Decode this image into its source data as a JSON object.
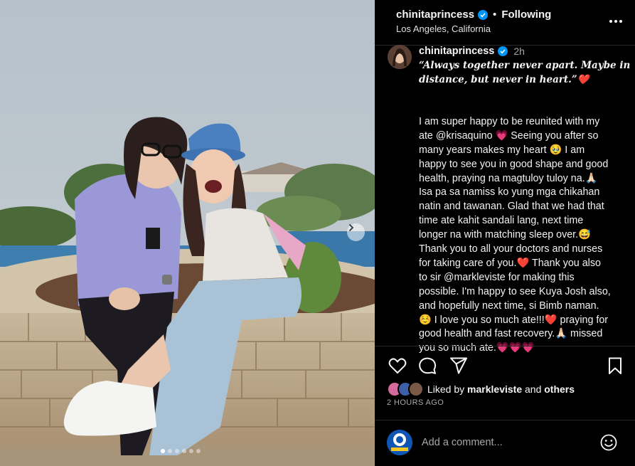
{
  "post": {
    "author": "chinitaprincess",
    "separator": "•",
    "follow_status": "Following",
    "location": "Los Angeles, California"
  },
  "caption": {
    "author": "chinitaprincess",
    "time": "2h",
    "quote_lines": [
      "“Always together never apart. Maybe in",
      "distance, but never in heart.”❤️"
    ],
    "body_lines": [
      "",
      "I am super happy to be reunited with my",
      "ate @krisaquino 💗 Seeing you after so",
      "many years makes my heart 🥹 I am",
      "happy to see you in good shape and good",
      "health, praying na magtuloy tuloy na.🙏🏻",
      "Isa pa sa namiss ko yung mga chikahan",
      "natin and tawanan. Glad that we had that",
      "time ate kahit sandali lang, next time",
      "longer na with matching sleep over.😅",
      "Thank you to all your doctors and nurses",
      "for taking care of you.❤️ Thank you also",
      "to sir @markleviste for making this",
      "possible. I'm happy to see Kuya Josh also,",
      "and hopefully next time, si Bimb naman.",
      "☺️ I love you so much ate!!!❤️ praying for",
      "good health and fast recovery.🙏🏻 missed",
      "you so much ate.💗💗💗"
    ]
  },
  "likes": {
    "prefix": "Liked by ",
    "user": "markleviste",
    "middle": " and ",
    "others": "others"
  },
  "time_ago": "2 HOURS AGO",
  "comment": {
    "placeholder": "Add a comment..."
  },
  "carousel": {
    "slide_count": 6,
    "active_index": 0
  },
  "icons": {
    "verified": "verified-badge-icon",
    "more": "more-options-icon",
    "like": "heart-icon",
    "comment": "comment-icon",
    "share": "share-icon",
    "save": "bookmark-icon",
    "emoji": "emoji-icon",
    "next": "chevron-right-icon"
  },
  "colors": {
    "verified_blue": "#0095f6",
    "text_secondary": "#a8a8a8",
    "divider": "#262626"
  }
}
